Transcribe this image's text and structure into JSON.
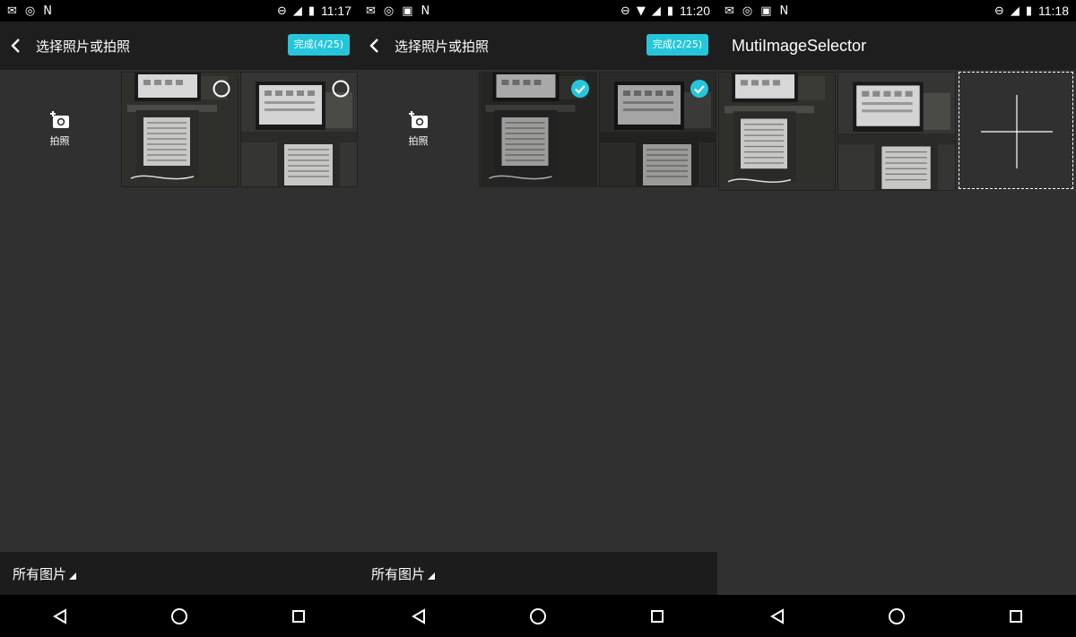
{
  "status_time": [
    "11:17",
    "11:20",
    "11:18"
  ],
  "screen1": {
    "title": "选择照片或拍照",
    "done": "完成(4/25)",
    "camera_label": "拍照",
    "folder": "所有图片",
    "selected": [
      false,
      false
    ]
  },
  "screen2": {
    "title": "选择照片或拍照",
    "done": "完成(2/25)",
    "camera_label": "拍照",
    "folder": "所有图片",
    "selected": [
      true,
      true
    ]
  },
  "screen3": {
    "title": "MutiImageSelector"
  },
  "colors": {
    "accent": "#26c6da",
    "surface": "#303030",
    "bar": "#1e1e1e"
  },
  "icons": [
    "back-arrow-icon",
    "camera-add-icon",
    "check-circle-icon",
    "empty-circle-icon",
    "plus-icon",
    "nav-back-icon",
    "nav-home-icon",
    "nav-recents-icon"
  ]
}
